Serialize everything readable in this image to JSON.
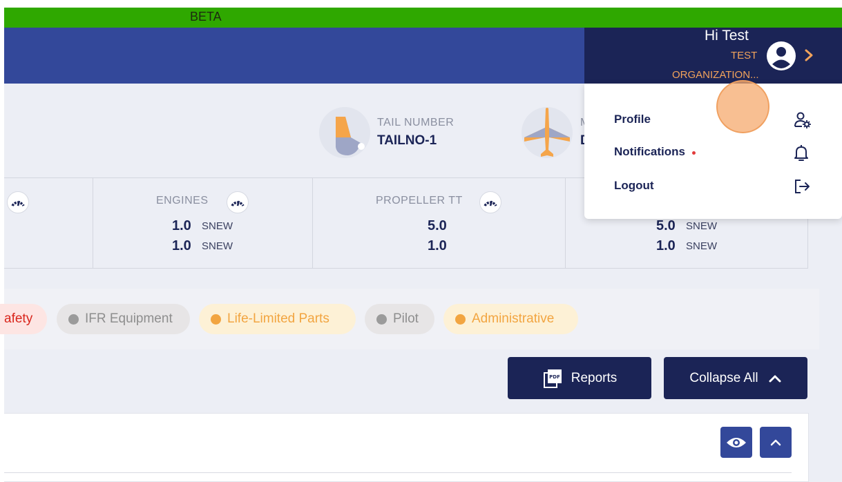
{
  "beta": {
    "label": "BETA"
  },
  "user": {
    "greeting": "Hi Test",
    "org_line1": "TEST",
    "org_line2": "ORGANIZATION..."
  },
  "aircraft": {
    "tail_label": "TAIL NUMBER",
    "tail_value": "TAILNO-1",
    "model_label_partial": "M",
    "model_value_partial": "D"
  },
  "stats": [
    {
      "label": "ENGINES",
      "v1": "1.0",
      "u1": "SNEW",
      "v2": "1.0",
      "u2": "SNEW"
    },
    {
      "label": "PROPELLER TT",
      "v1": "5.0",
      "u1": "",
      "v2": "1.0",
      "u2": ""
    },
    {
      "label": "",
      "v1": "5.0",
      "u1": "SNEW",
      "v2": "1.0",
      "u2": "SNEW"
    }
  ],
  "filters": [
    {
      "label": "afety",
      "color": "#d9261c"
    },
    {
      "label": "IFR Equipment",
      "color": "#9b9b9b"
    },
    {
      "label": "Life-Limited Parts",
      "color": "#f2a541"
    },
    {
      "label": "Pilot",
      "color": "#9b9b9b"
    },
    {
      "label": "Administrative",
      "color": "#f2a541"
    }
  ],
  "actions": {
    "reports": "Reports",
    "collapse_all": "Collapse All"
  },
  "menu": {
    "profile": "Profile",
    "notifications": "Notifications",
    "logout": "Logout"
  },
  "colors": {
    "navy": "#1b2456",
    "header_blue": "#33489a",
    "accent_orange": "#f2a35b",
    "beta_green": "#2fa800"
  }
}
